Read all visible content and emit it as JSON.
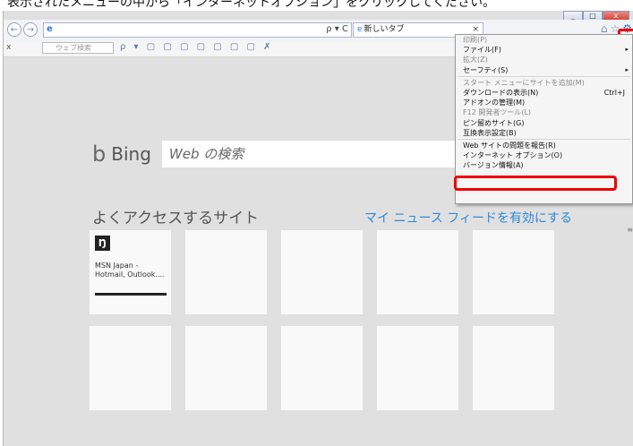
{
  "caption": "表示されたメニューの中から「インターネットオプション」をクリックしてください。",
  "window_controls": {
    "minimize": "_",
    "maximize": "□",
    "close": "x"
  },
  "nav": {
    "back": "←",
    "forward": "→",
    "address_tools": "ρ ▾ C"
  },
  "tab": {
    "icon": "e",
    "label": "新しいタブ",
    "close": "×"
  },
  "right_icons": {
    "home": "⌂",
    "favorites": "☆",
    "gear": "⚙",
    "gear_icon_name": "gear-icon"
  },
  "toolbar": {
    "close": "x",
    "search_placeholder": "ウェブ検索",
    "icons": "ρ ▾ ▢ ▢ ▢ ▢ ▢ ▢ ▢ ✗"
  },
  "bing": {
    "logo": "b",
    "name": "Bing",
    "search_placeholder": "Web の検索"
  },
  "frequent": {
    "title": "よくアクセスするサイト",
    "news_link": "マイ ニュース フィードを有効にする"
  },
  "tile_msn": {
    "logo": "Ŋ",
    "title": "MSN Japan -\nHotmail, Outlook...."
  },
  "menu": {
    "items": [
      {
        "label": "印刷(P)",
        "disabled": false,
        "arrow": ""
      },
      {
        "label": "ファイル(F)",
        "disabled": false,
        "arrow": "▸"
      },
      {
        "label": "拡大(Z)",
        "disabled": false,
        "arrow": ""
      },
      {
        "label": "セーフティ(S)",
        "disabled": false,
        "arrow": "▸"
      },
      {
        "label": "スタート メニューにサイトを追加(M)",
        "disabled": true,
        "arrow": ""
      },
      {
        "label": "ダウンロードの表示(N)",
        "disabled": false,
        "shortcut": "Ctrl+J"
      },
      {
        "label": "アドオンの管理(M)",
        "disabled": false
      },
      {
        "label": "F12 開発者ツール(L)",
        "disabled": true
      },
      {
        "label": "ピン留めサイト(G)",
        "disabled": false
      },
      {
        "label": "互換表示設定(B)",
        "disabled": false
      },
      {
        "label": "Web サイトの問題を報告(R)",
        "disabled": false
      },
      {
        "label": "インターネット オプション(O)",
        "disabled": false
      },
      {
        "label": "バージョン情報(A)",
        "disabled": false
      }
    ]
  },
  "colors": {
    "highlight_red": "#ee0000",
    "link_blue": "#2d8ad8",
    "page_bg": "#e0e0e0"
  }
}
